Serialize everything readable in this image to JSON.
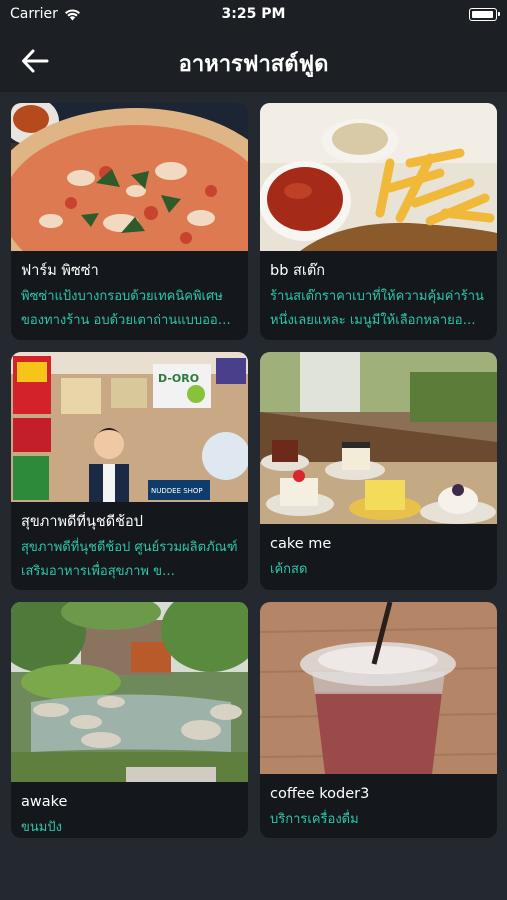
{
  "status": {
    "carrier": "Carrier",
    "time": "3:25 PM"
  },
  "nav": {
    "title": "อาหารฟาสต์ฟูด"
  },
  "cards": [
    {
      "name": "ฟาร์ม พิซซ่า",
      "desc": "พิซซ่าแป้งบางกรอบด้วยเทคนิคพิเศษของทางร้าน อบด้วยเตาถ่านแบบออ…"
    },
    {
      "name": "bb สเต๊ก",
      "desc": "ร้านสเต๊กราคาเบาที่ให้ความคุ้มค่าร้านหนึ่งเลยแหละ เมนูมีให้เลือกหลายอ…"
    },
    {
      "name": "สุขภาพดีที่นุชดีช้อป",
      "desc": "สุขภาพดีที่นุชดีช้อป ศูนย์รวมผลิตภัณฑ์เสริมอาหารเพื่อสุขภาพ ข…"
    },
    {
      "name": "cake me",
      "desc": "เค้กสด"
    },
    {
      "name": "awake",
      "desc": "ขนมปัง"
    },
    {
      "name": "coffee koder3",
      "desc": "บริการเครื่องดื่ม"
    }
  ],
  "shop_sign": "NUDDEE SHOP",
  "product_label": "D-ORO",
  "colors": {
    "background": "#24292f",
    "card": "#14181c",
    "accent": "#2ec4a9"
  }
}
